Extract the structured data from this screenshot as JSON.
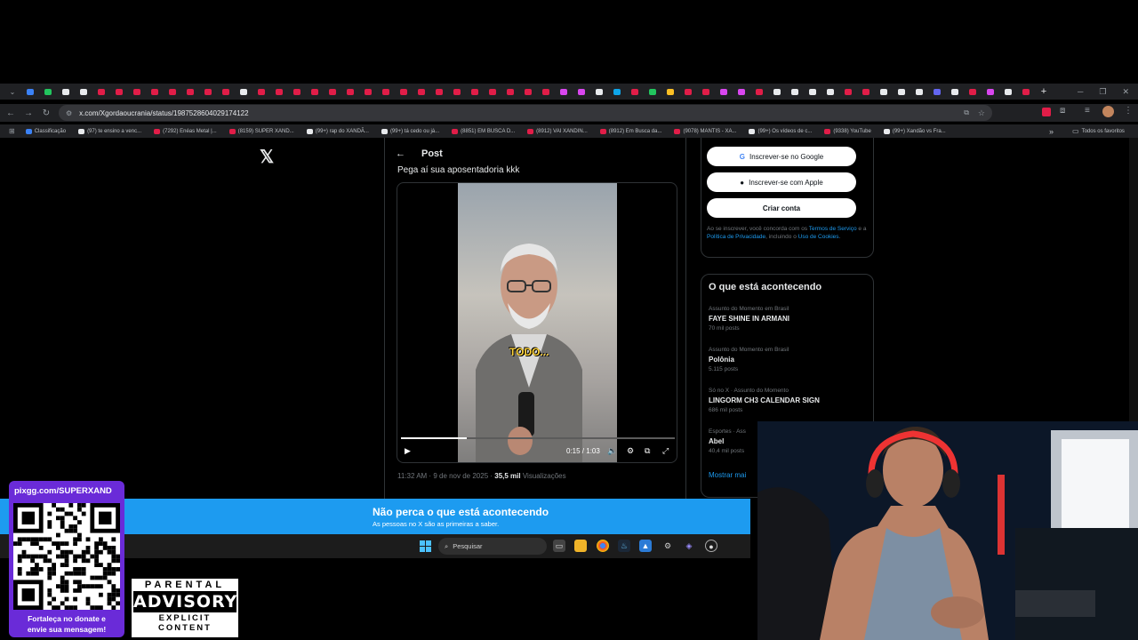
{
  "browser": {
    "tab_favicon_colors": [
      "#3b82f6",
      "#22c55e",
      "#e8eaed",
      "#e8eaed",
      "#e11d48",
      "#e11d48",
      "#e11d48",
      "#e11d48",
      "#e11d48",
      "#e11d48",
      "#e11d48",
      "#e11d48",
      "#e8eaed",
      "#e11d48",
      "#e11d48",
      "#e11d48",
      "#e11d48",
      "#e11d48",
      "#e11d48",
      "#e11d48",
      "#e11d48",
      "#e11d48",
      "#e11d48",
      "#e11d48",
      "#e11d48",
      "#e11d48",
      "#e11d48",
      "#e11d48",
      "#e11d48",
      "#e11d48",
      "#d946ef",
      "#d946ef",
      "#e8eaed",
      "#0ea5e9",
      "#e11d48",
      "#22c55e",
      "#fbbf24",
      "#e11d48",
      "#e11d48",
      "#d946ef",
      "#d946ef",
      "#e11d48",
      "#e8eaed",
      "#e8eaed",
      "#e8eaed",
      "#e8eaed",
      "#e11d48",
      "#e11d48",
      "#e8eaed",
      "#e8eaed",
      "#e8eaed",
      "#6366f1",
      "#e8eaed",
      "#e11d48",
      "#d946ef",
      "#e8eaed",
      "#e11d48"
    ],
    "new_tab_label": "+",
    "url": "x.com/Xgordaoucrania/status/1987528604029174122",
    "bookmarks": [
      {
        "label": "Classificação",
        "color": "#3b82f6"
      },
      {
        "label": "(97) te ensino a venc...",
        "color": "#e8eaed"
      },
      {
        "label": "(7292) Enéas Metal |...",
        "color": "#e11d48"
      },
      {
        "label": "(8159) SUPER XAND...",
        "color": "#e11d48"
      },
      {
        "label": "(99+) rap do XANDÃ...",
        "color": "#e8eaed"
      },
      {
        "label": "(99+) tá cedo ou já...",
        "color": "#e8eaed"
      },
      {
        "label": "(8851) EM BUSCA D...",
        "color": "#e11d48"
      },
      {
        "label": "(8912) VAI XANDIN...",
        "color": "#e11d48"
      },
      {
        "label": "(8912) Em Busca da...",
        "color": "#e11d48"
      },
      {
        "label": "(9078) MANTIS - XA...",
        "color": "#e11d48"
      },
      {
        "label": "(99+) Os vídeos de c...",
        "color": "#e8eaed"
      },
      {
        "label": "(9338) YouTube",
        "color": "#e11d48"
      },
      {
        "label": "(99+) Xandão vs Fra...",
        "color": "#e8eaed"
      }
    ],
    "bookmarks_overflow": "»",
    "all_bookmarks": "Todos os favoritos"
  },
  "x": {
    "logo": "𝕏",
    "back_arrow": "←",
    "header_title": "Post",
    "post_text": "Pega aí sua aposentadoria kkk",
    "video": {
      "caption": "TODO...",
      "time": "0:15 / 1:03",
      "progress": 0.24
    },
    "meta_time": "11:32 AM · 9 de nov de 2025 · ",
    "meta_views_count": "35,5 mil",
    "meta_views_label": " Visualizações",
    "signup": {
      "google": "Inscrever-se no Google",
      "apple": "Inscrever-se com Apple",
      "create": "Criar conta",
      "terms_pre": "Ao se inscrever, você concorda com os ",
      "terms_link": "Termos de Serviço",
      "terms_mid": " e a ",
      "privacy_link": "Política de Privacidade",
      "terms_mid2": ", incluindo o ",
      "cookies_link": "Uso de Cookies",
      "terms_end": "."
    },
    "trends_title": "O que está acontecendo",
    "trends": [
      {
        "context": "Assunto do Momento em Brasil",
        "name": "FAYE SHINE IN ARMANI",
        "count": "70 mil posts"
      },
      {
        "context": "Assunto do Momento em Brasil",
        "name": "Polônia",
        "count": "5.115 posts"
      },
      {
        "context": "Só no X · Assunto do Momento",
        "name": "LINGORM CH3 CALENDAR SIGN",
        "count": "686 mil posts"
      },
      {
        "context": "Esportes · Ass",
        "name": "Abel",
        "count": "40,4 mil posts"
      }
    ],
    "show_more": "Mostrar mai"
  },
  "banner": {
    "title": "Não perca o que está acontecendo",
    "subtitle": "As pessoas no X são as primeiras a saber."
  },
  "taskbar": {
    "search_placeholder": "Pesquisar"
  },
  "overlay": {
    "donate_url": "pixgg.com/SUPERXAND",
    "donate_msg_1": "Fortaleça no donate e",
    "donate_msg_2": "envie sua mensagem!",
    "advisory_1": "PARENTAL",
    "advisory_2": "ADVISORY",
    "advisory_3": "EXPLICIT CONTENT"
  }
}
